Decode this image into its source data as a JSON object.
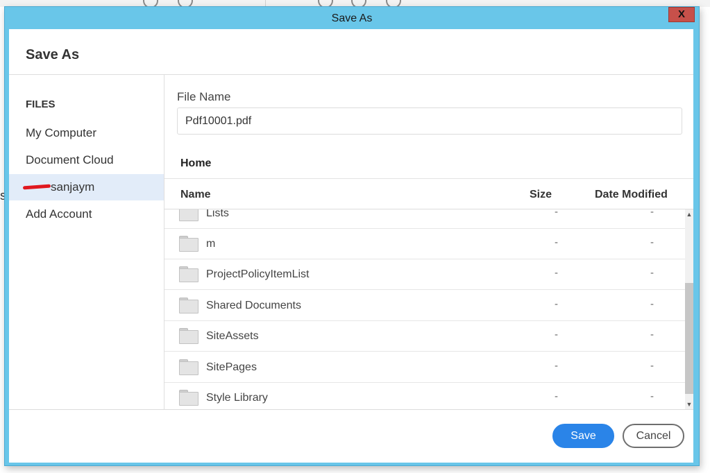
{
  "window": {
    "title": "Save As",
    "close_label": "X",
    "accent_color": "#69c6e9"
  },
  "dialog": {
    "title": "Save As"
  },
  "sidebar": {
    "heading": "FILES",
    "items": [
      {
        "label": "My Computer",
        "active": false
      },
      {
        "label": "Document Cloud",
        "active": false
      },
      {
        "label": "sanjaym",
        "active": true
      },
      {
        "label": "Add Account",
        "active": false
      }
    ]
  },
  "file_name": {
    "label": "File Name",
    "value": "Pdf10001.pdf"
  },
  "location": "Home",
  "table": {
    "columns": {
      "name": "Name",
      "size": "Size",
      "date": "Date Modified"
    },
    "rows": [
      {
        "name": "Lists",
        "size": "-",
        "date": "-"
      },
      {
        "name": "m",
        "size": "-",
        "date": "-"
      },
      {
        "name": "ProjectPolicyItemList",
        "size": "-",
        "date": "-"
      },
      {
        "name": "Shared Documents",
        "size": "-",
        "date": "-"
      },
      {
        "name": "SiteAssets",
        "size": "-",
        "date": "-"
      },
      {
        "name": "SitePages",
        "size": "-",
        "date": "-"
      },
      {
        "name": "Style Library",
        "size": "-",
        "date": "-"
      }
    ]
  },
  "footer": {
    "save_label": "Save",
    "cancel_label": "Cancel",
    "save_color": "#2a84e8"
  },
  "background_text": "s"
}
